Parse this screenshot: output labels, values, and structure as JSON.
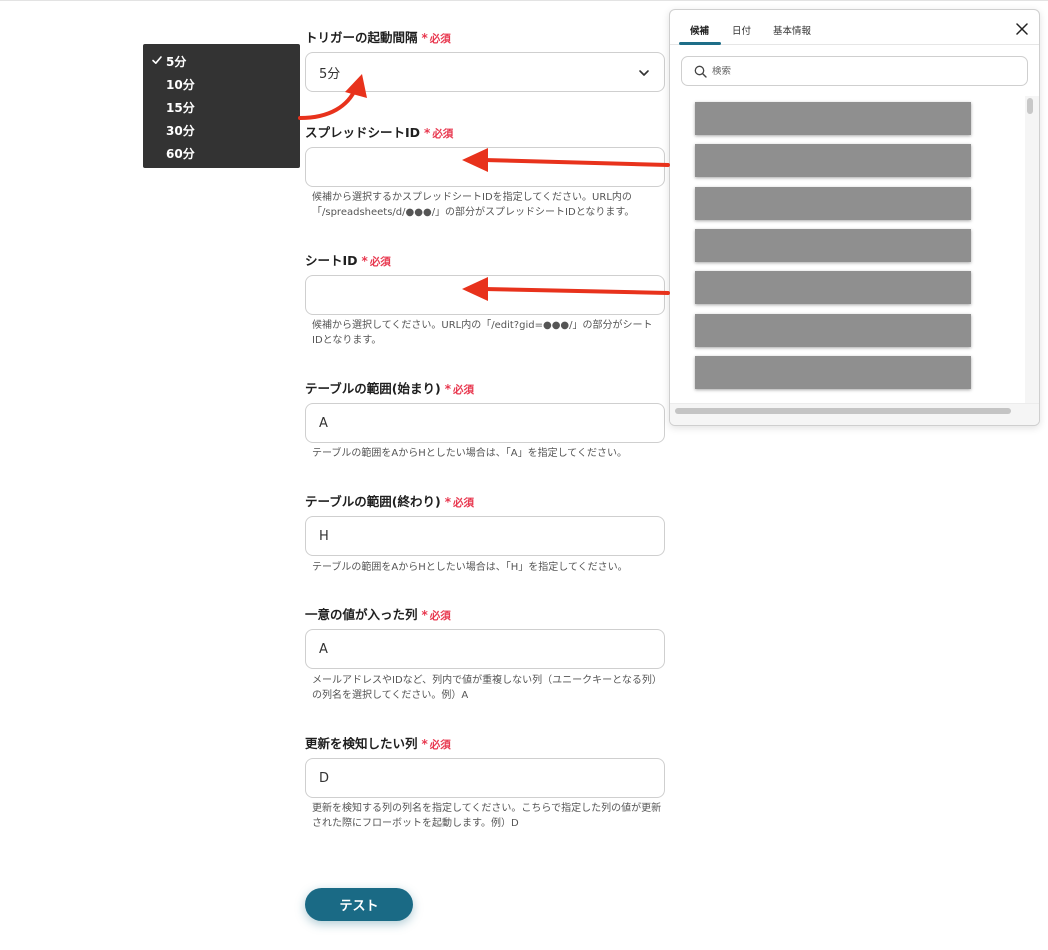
{
  "fields": {
    "interval": {
      "label": "トリガーの起動間隔",
      "required": "必須",
      "value": "5分"
    },
    "spreadsheet_id": {
      "label": "スプレッドシートID",
      "required": "必須",
      "value": "",
      "help_line1": "候補から選択するかスプレッドシートIDを指定してください。URL内の",
      "help_line2": "「/spreadsheets/d/●●●/」の部分がスプレッドシートIDとなります。"
    },
    "sheet_id": {
      "label": "シートID",
      "required": "必須",
      "value": "",
      "help_line1": "候補から選択してください。URL内の「/edit?gid=●●●/」の部分がシート",
      "help_line2": "IDとなります。"
    },
    "range_start": {
      "label": "テーブルの範囲(始まり)",
      "required": "必須",
      "value": "A",
      "help_line1": "テーブルの範囲をAからHとしたい場合は、「A」を指定してください。"
    },
    "range_end": {
      "label": "テーブルの範囲(終わり)",
      "required": "必須",
      "value": "H",
      "help_line1": "テーブルの範囲をAからHとしたい場合は、「H」を指定してください。"
    },
    "unique_column": {
      "label": "一意の値が入った列",
      "required": "必須",
      "value": "A",
      "help_line1": "メールアドレスやIDなど、列内で値が重複しない列（ユニークキーとなる列）",
      "help_line2": "の列名を選択してください。例）A"
    },
    "watch_column": {
      "label": "更新を検知したい列",
      "required": "必須",
      "value": "D",
      "help_line1": "更新を検知する列の列名を指定してください。こちらで指定した列の値が更新",
      "help_line2": "された際にフローボットを起動します。例）D"
    }
  },
  "interval_dropdown": {
    "options": [
      "5分",
      "10分",
      "15分",
      "30分",
      "60分"
    ],
    "selected": "5分"
  },
  "candidate_panel": {
    "tabs": [
      "候補",
      "日付",
      "基本情報"
    ],
    "active_tab": "候補",
    "search_placeholder": "検索",
    "item_count": 7
  },
  "test_button": "テスト",
  "colors": {
    "accent": "#1a6a85",
    "required": "#e8384f",
    "arrow": "#e8321c",
    "dropdown_bg": "#333333",
    "redacted_item": "#8f8f8f"
  },
  "icons": [
    "chevron-down-icon",
    "check-icon",
    "close-icon",
    "search-icon"
  ]
}
